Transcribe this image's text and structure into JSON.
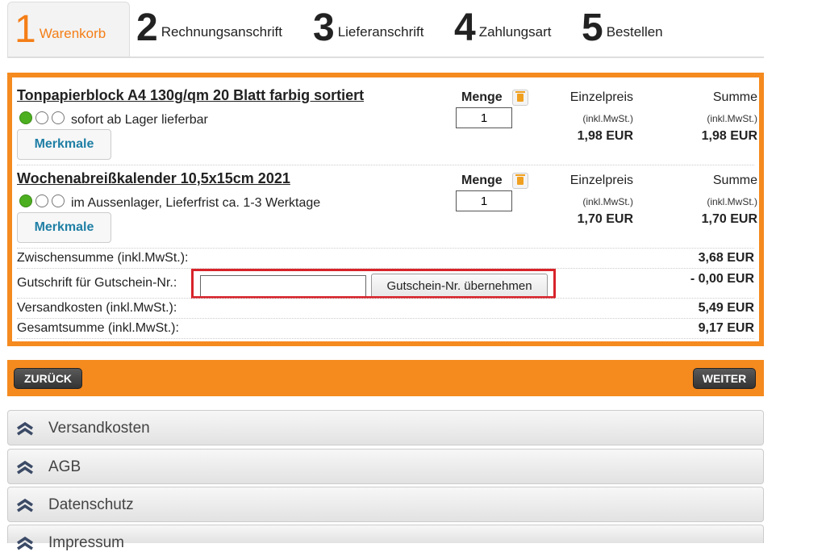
{
  "steps": [
    {
      "num": "1",
      "label": "Warenkorb"
    },
    {
      "num": "2",
      "label": "Rechnungsanschrift"
    },
    {
      "num": "3",
      "label": "Lieferanschrift"
    },
    {
      "num": "4",
      "label": "Zahlungsart"
    },
    {
      "num": "5",
      "label": "Bestellen"
    }
  ],
  "cart": {
    "menge_label": "Menge",
    "einzelpreis_label": "Einzelpreis",
    "summe_label": "Summe",
    "inkl_label": "(inkl.MwSt.)",
    "merkmale_label": "Merkmale",
    "items": [
      {
        "title": "Tonpapierblock A4 130g/qm 20 Blatt farbig sortiert",
        "availability": "sofort ab Lager lieferbar",
        "qty": "1",
        "unit_price": "1,98 EUR",
        "total": "1,98 EUR"
      },
      {
        "title": "Wochenabreißkalender 10,5x15cm 2021",
        "availability": "im Aussenlager, Lieferfrist ca. 1-3 Werktage",
        "qty": "1",
        "unit_price": "1,70 EUR",
        "total": "1,70 EUR"
      }
    ],
    "subtotal_label": "Zwischensumme (inkl.MwSt.):",
    "subtotal": "3,68 EUR",
    "voucher_label": "Gutschrift für Gutschein-Nr.:",
    "voucher_value": "",
    "voucher_button": "Gutschein-Nr. übernehmen",
    "voucher_amount": "- 0,00 EUR",
    "shipping_label": "Versandkosten (inkl.MwSt.):",
    "shipping": "5,49 EUR",
    "total_label": "Gesamtsumme (inkl.MwSt.):",
    "total": "9,17 EUR"
  },
  "nav": {
    "back": "ZURÜCK",
    "next": "WEITER"
  },
  "accordions": [
    "Versandkosten",
    "AGB",
    "Datenschutz",
    "Impressum"
  ],
  "colors": {
    "accent": "#f58a1f",
    "highlight": "#d8232a",
    "link": "#1f7fa5"
  }
}
